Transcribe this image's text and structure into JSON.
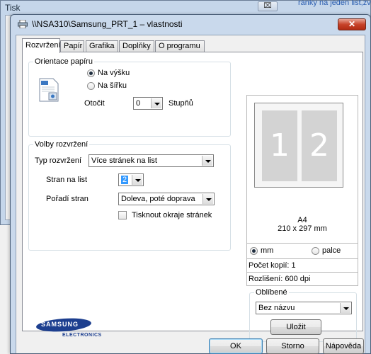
{
  "background_window": {
    "title": "Tisk",
    "close_label": "⌧",
    "top_right_text": "ránky na jeden list,zv"
  },
  "dialog": {
    "title": "\\\\NSA310\\Samsung_PRT_1 – vlastnosti",
    "close_label": "✕",
    "tabs": [
      {
        "label": "Rozvržení",
        "active": true
      },
      {
        "label": "Papír",
        "active": false
      },
      {
        "label": "Grafika",
        "active": false
      },
      {
        "label": "Doplňky",
        "active": false
      },
      {
        "label": "O programu",
        "active": false
      }
    ],
    "orientation": {
      "legend": "Orientace papíru",
      "portrait_label": "Na výšku",
      "landscape_label": "Na šířku",
      "selected": "portrait",
      "rotate_label": "Otočit",
      "rotate_value": "0",
      "degrees_label": "Stupňů"
    },
    "layout_options": {
      "legend": "Volby rozvržení",
      "layout_type_label": "Typ rozvržení",
      "layout_type_value": "Více stránek na list",
      "pages_per_sheet_label": "Stran na list",
      "pages_per_sheet_value": "2",
      "page_order_label": "Pořadí stran",
      "page_order_value": "Doleva, poté doprava",
      "print_borders_label": "Tisknout okraje stránek",
      "print_borders_checked": false
    },
    "preview": {
      "page_numbers": [
        "1",
        "2"
      ],
      "paper_size": "A4",
      "dimensions": "210 x 297 mm",
      "unit_mm_label": "mm",
      "unit_inch_label": "palce",
      "unit_selected": "mm",
      "copies_text": "Počet kopií: 1",
      "resolution_text": "Rozlišení: 600 dpi"
    },
    "favorites": {
      "legend": "Oblíbené",
      "value": "Bez názvu",
      "save_label": "Uložit"
    },
    "brand": {
      "name": "SAMSUNG",
      "subtitle": "ELECTRONICS",
      "color": "#1d3f8f"
    },
    "footer": {
      "ok_label": "OK",
      "cancel_label": "Storno",
      "help_label": "Nápověda"
    }
  }
}
